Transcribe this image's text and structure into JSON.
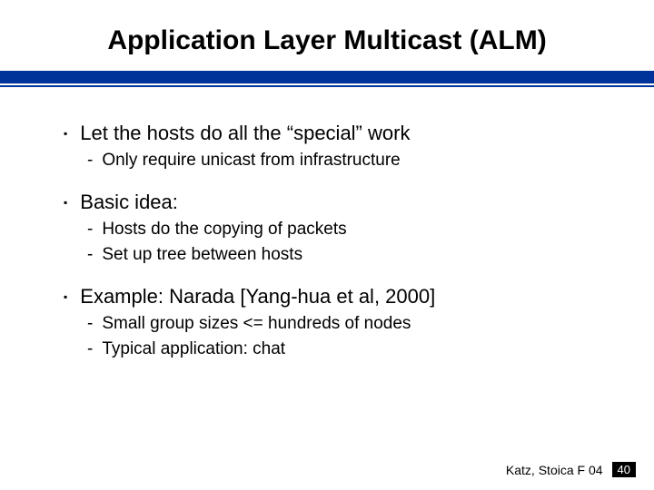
{
  "title": "Application Layer Multicast (ALM)",
  "bullets": {
    "b1": {
      "text": "Let the hosts do all the “special” work"
    },
    "b1_1": {
      "text": "Only require unicast from infrastructure"
    },
    "b2": {
      "text": "Basic idea:"
    },
    "b2_1": {
      "text": "Hosts do the copying of packets"
    },
    "b2_2": {
      "text": "Set up tree between hosts"
    },
    "b3": {
      "text": "Example: Narada [Yang-hua et al, 2000]"
    },
    "b3_1": {
      "text": "Small group sizes <= hundreds of nodes"
    },
    "b3_2": {
      "text": "Typical application: chat"
    }
  },
  "footer": {
    "credit": "Katz, Stoica F 04",
    "page": "40"
  },
  "glyphs": {
    "square": "▪",
    "dash": "-"
  }
}
